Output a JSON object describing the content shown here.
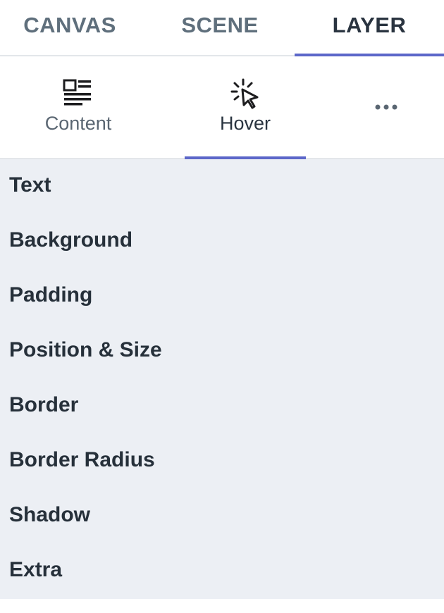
{
  "top_tabs": [
    {
      "label": "CANVAS",
      "active": false
    },
    {
      "label": "SCENE",
      "active": false
    },
    {
      "label": "LAYER",
      "active": true
    }
  ],
  "sub_tabs": [
    {
      "label": "Content",
      "icon": "content-icon",
      "active": false
    },
    {
      "label": "Hover",
      "icon": "cursor-click-icon",
      "active": true
    },
    {
      "label": "",
      "icon": "more-icon",
      "active": false
    }
  ],
  "sections": [
    {
      "label": "Text"
    },
    {
      "label": "Background"
    },
    {
      "label": "Padding"
    },
    {
      "label": "Position & Size"
    },
    {
      "label": "Border"
    },
    {
      "label": "Border Radius"
    },
    {
      "label": "Shadow"
    },
    {
      "label": "Extra"
    }
  ],
  "colors": {
    "accent": "#5c67c9",
    "panel_background": "#eceff4",
    "active_text": "#2a3440",
    "inactive_text": "#5f6f7c"
  }
}
